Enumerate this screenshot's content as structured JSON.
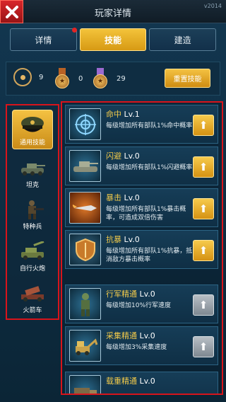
{
  "header": {
    "title": "玩家详情",
    "version": "v2014"
  },
  "tabs": [
    {
      "label": "详情",
      "active": false
    },
    {
      "label": "技能",
      "active": true
    },
    {
      "label": "建造",
      "active": false
    }
  ],
  "stats": {
    "atom_count": "9",
    "bronze_count": "0",
    "silver_count": "29",
    "reset_label": "重置技能"
  },
  "categories": [
    {
      "label": "通用技能",
      "active": true
    },
    {
      "label": "坦克",
      "active": false
    },
    {
      "label": "特种兵",
      "active": false
    },
    {
      "label": "自行火炮",
      "active": false
    },
    {
      "label": "火箭车",
      "active": false
    }
  ],
  "skills": [
    {
      "name": "命中",
      "level": "Lv.1",
      "desc": "每级增加所有部队1%命中概率",
      "upgradable": true,
      "icon": "crosshair-icon"
    },
    {
      "name": "闪避",
      "level": "Lv.0",
      "desc": "每级增加所有部队1%闪避概率",
      "upgradable": true,
      "icon": "tank-icon"
    },
    {
      "name": "暴击",
      "level": "Lv.0",
      "desc": "每级增加所有部队1%暴击概率，可造成双倍伤害",
      "upgradable": true,
      "icon": "missile-icon"
    },
    {
      "name": "抗暴",
      "level": "Lv.0",
      "desc": "每级增加所有部队1%抗暴，抵消敌方暴击概率",
      "upgradable": true,
      "icon": "shield-icon"
    },
    {
      "name": "行军精通",
      "level": "Lv.0",
      "desc": "每级增加10%行军速度",
      "upgradable": false,
      "icon": "soldier-icon"
    },
    {
      "name": "采集精通",
      "level": "Lv.0",
      "desc": "每级增加3%采集速度",
      "upgradable": false,
      "icon": "excavator-icon"
    },
    {
      "name": "载重精通",
      "level": "Lv.0",
      "desc": "",
      "upgradable": false,
      "icon": "truck-icon"
    }
  ],
  "colors": {
    "accent_gold": "#f3c33a",
    "highlight_red": "#d8141b",
    "disabled_gray": "#9aa3ab"
  }
}
